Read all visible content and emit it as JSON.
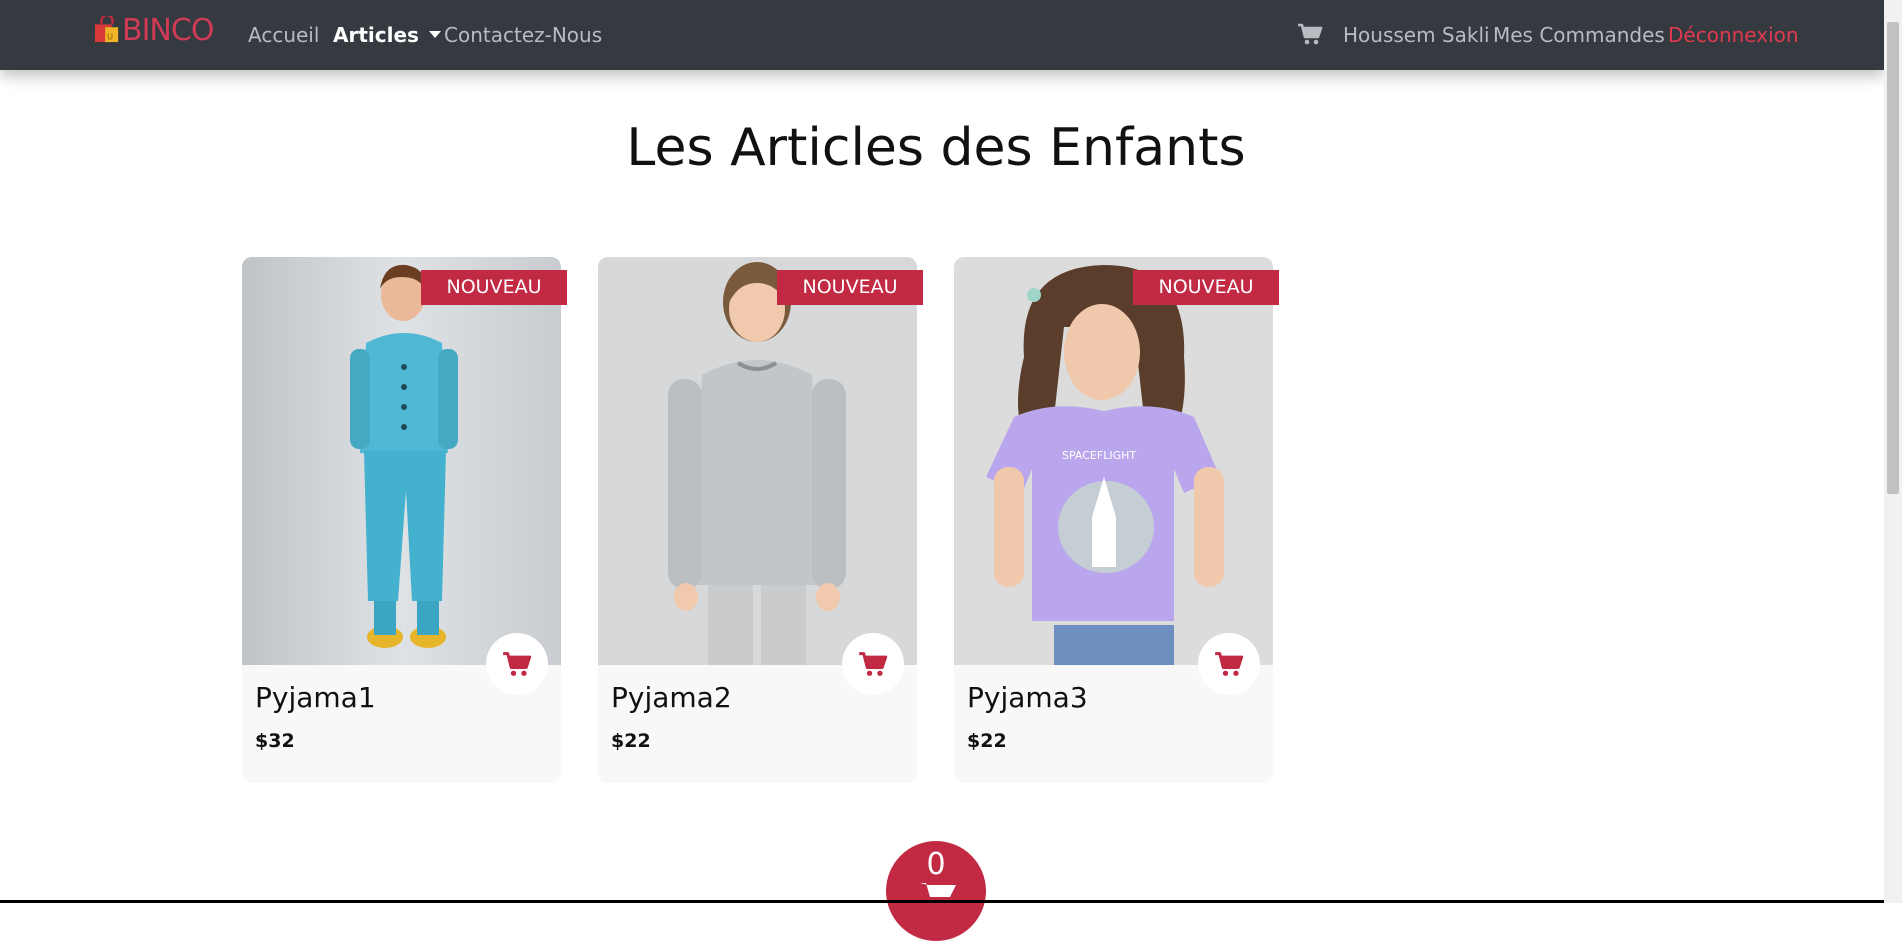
{
  "nav": {
    "brand": "BINCO",
    "links": [
      "Accueil",
      "Articles",
      "Contactez-Nous"
    ],
    "user": "Houssem Sakli",
    "orders": "Mes Commandes",
    "logout": "Déconnexion"
  },
  "page": {
    "title": "Les Articles des Enfants"
  },
  "products": [
    {
      "badge": "NOUVEAU",
      "name": "Pyjama1",
      "price": "$32"
    },
    {
      "badge": "NOUVEAU",
      "name": "Pyjama2",
      "price": "$22"
    },
    {
      "badge": "NOUVEAU",
      "name": "Pyjama3",
      "price": "$22"
    }
  ],
  "cart": {
    "count": "0"
  },
  "colors": {
    "navbar": "#343a40",
    "accent": "#c22a44",
    "logout": "#e0394f",
    "card": "#f8f8f8"
  },
  "icons": [
    "shopping-bag-icon",
    "cart-icon",
    "chevron-down-icon"
  ]
}
